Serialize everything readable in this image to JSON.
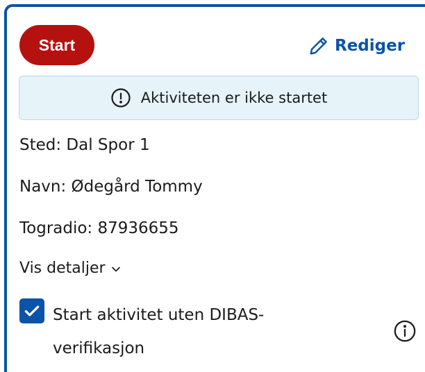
{
  "actions": {
    "start_label": "Start",
    "edit_label": "Rediger",
    "edit_icon": "pencil-icon"
  },
  "status_banner": {
    "icon": "alert-circle-icon",
    "text": "Aktiviteten er ikke startet"
  },
  "details": {
    "location": "Sted: Dal Spor 1",
    "name": "Navn: Ødegård Tommy",
    "radio": "Togradio: 87936655",
    "toggle_label": "Vis detaljer",
    "toggle_icon": "chevron-down-icon"
  },
  "verification": {
    "checked": true,
    "label_line1": "Start aktivitet uten DIBAS-",
    "label_line2": "verifikasjon",
    "info_icon": "info-icon"
  },
  "colors": {
    "primary": "#0a53a8",
    "start_button": "#b5120f",
    "banner_bg": "#e6f3f8",
    "banner_border": "#b8dbe9",
    "text": "#1b1b1b"
  }
}
